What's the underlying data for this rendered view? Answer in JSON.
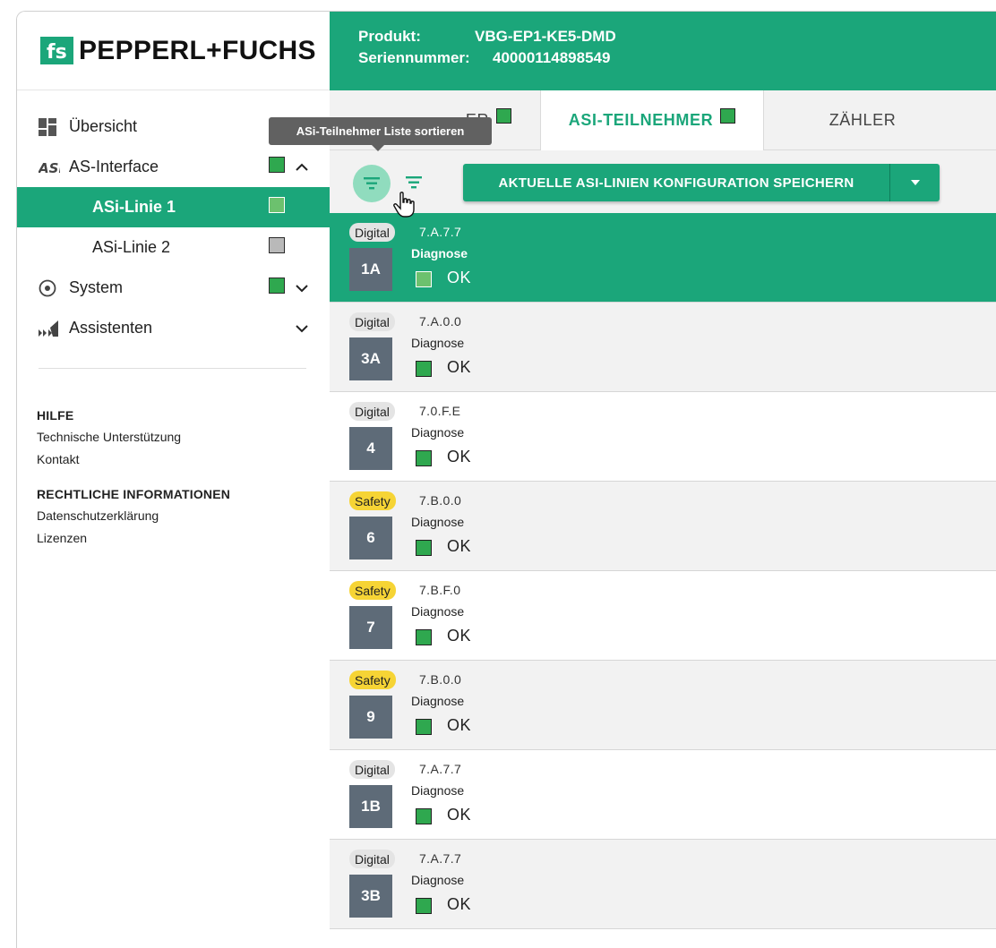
{
  "brand": {
    "logo_mark": "FS",
    "logo_text": "PEPPERL+FUCHS",
    "color": "#1ba67a"
  },
  "header": {
    "produkt_label": "Produkt:",
    "produkt_value": "VBG-EP1-KE5-DMD",
    "serial_label": "Seriennummer:",
    "serial_value": "40000114898549"
  },
  "sidebar": {
    "items": [
      {
        "label": "Übersicht",
        "icon": "overview-grid-icon"
      },
      {
        "label": "AS-Interface",
        "icon": "asi-icon",
        "status": "green",
        "chevron": "up"
      },
      {
        "label": "ASi-Linie 1",
        "status": "green",
        "active": true
      },
      {
        "label": "ASi-Linie 2",
        "status": "grey"
      },
      {
        "label": "System",
        "icon": "system-target-icon",
        "status": "green",
        "chevron": "down"
      },
      {
        "label": "Assistenten",
        "icon": "assistants-icon",
        "chevron": "down"
      }
    ],
    "help_heading": "HILFE",
    "help_links": [
      "Technische Unterstützung",
      "Kontakt"
    ],
    "legal_heading": "RECHTLICHE INFORMATIONEN",
    "legal_links": [
      "Datenschutzerklärung",
      "Lizenzen"
    ]
  },
  "tabs": [
    {
      "label": "ASI-MASTER",
      "visible_label": "ER"
    },
    {
      "label": "ASI-TEILNEHMER",
      "active": true
    },
    {
      "label": "ZÄHLER"
    }
  ],
  "toolbar": {
    "tooltip": "ASi-Teilnehmer Liste sortieren",
    "save_label": "AKTUELLE ASI-LINIEN KONFIGURATION SPEICHERN"
  },
  "slaves": [
    {
      "type": "Digital",
      "version": "7.A.7.7",
      "address": "1A",
      "diag_label": "Diagnose",
      "status": "OK",
      "selected": true
    },
    {
      "type": "Digital",
      "version": "7.A.0.0",
      "address": "3A",
      "diag_label": "Diagnose",
      "status": "OK"
    },
    {
      "type": "Digital",
      "version": "7.0.F.E",
      "address": "4",
      "diag_label": "Diagnose",
      "status": "OK"
    },
    {
      "type": "Safety",
      "version": "7.B.0.0",
      "address": "6",
      "diag_label": "Diagnose",
      "status": "OK"
    },
    {
      "type": "Safety",
      "version": "7.B.F.0",
      "address": "7",
      "diag_label": "Diagnose",
      "status": "OK"
    },
    {
      "type": "Safety",
      "version": "7.B.0.0",
      "address": "9",
      "diag_label": "Diagnose",
      "status": "OK"
    },
    {
      "type": "Digital",
      "version": "7.A.7.7",
      "address": "1B",
      "diag_label": "Diagnose",
      "status": "OK"
    },
    {
      "type": "Digital",
      "version": "7.A.7.7",
      "address": "3B",
      "diag_label": "Diagnose",
      "status": "OK"
    }
  ]
}
